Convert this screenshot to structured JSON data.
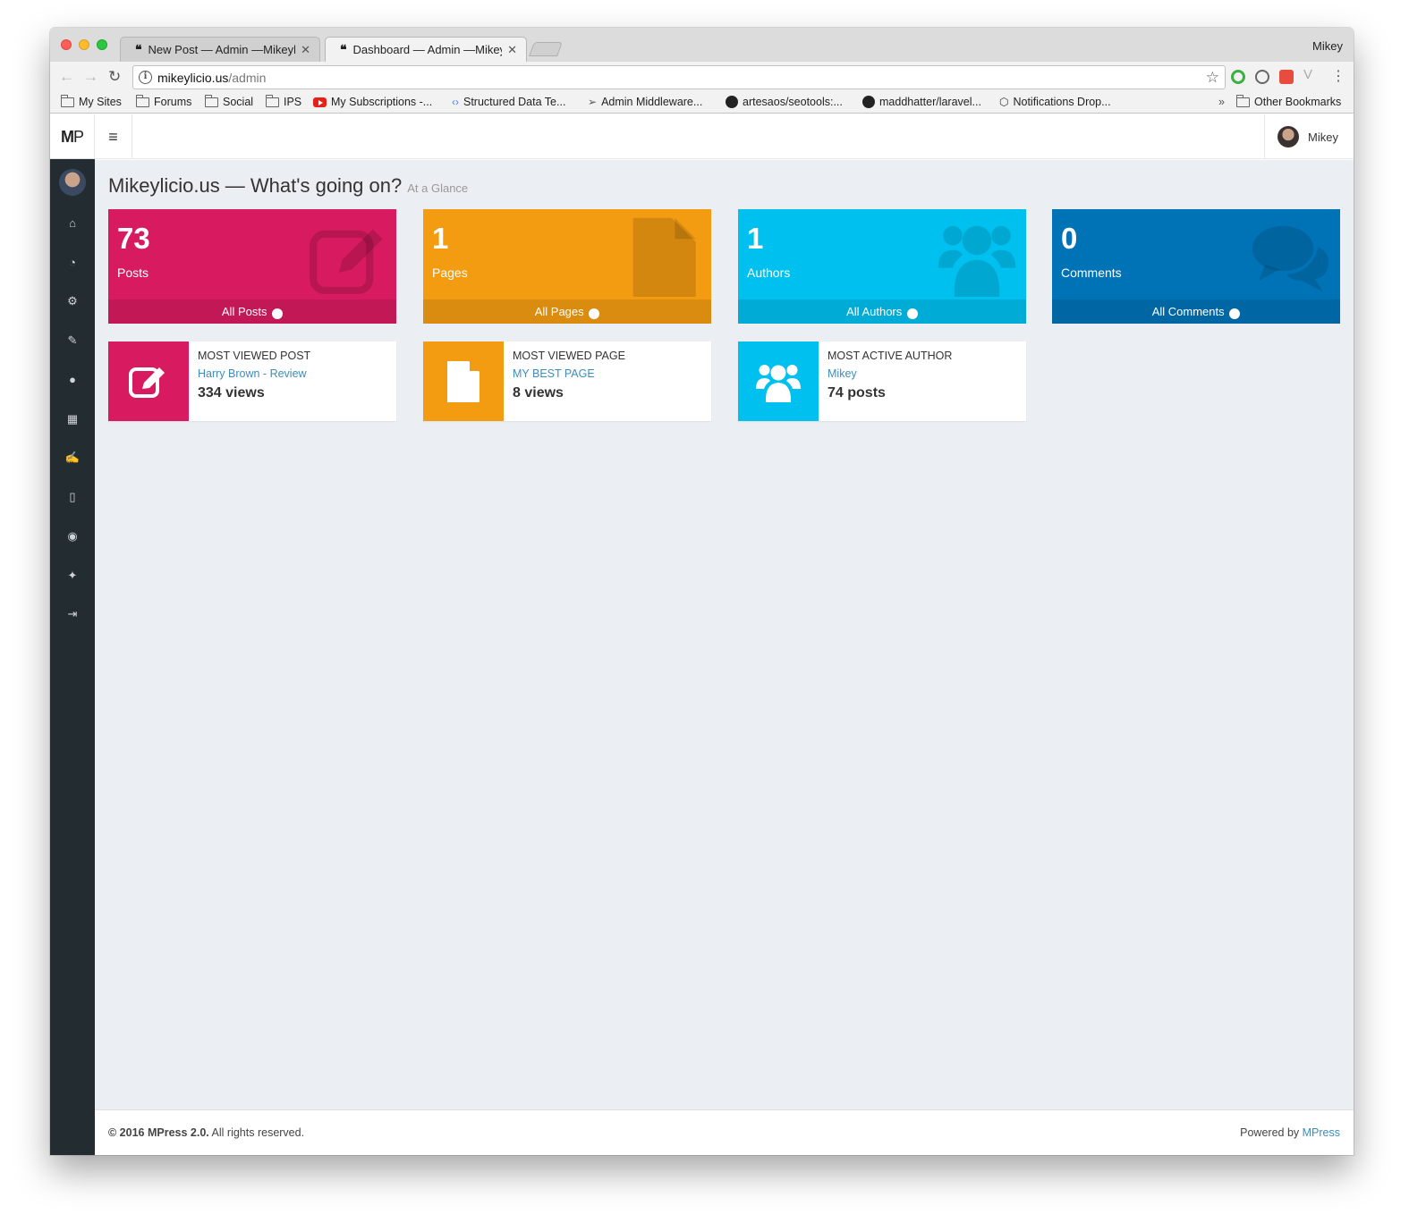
{
  "browser": {
    "profile_name": "Mikey",
    "tabs": [
      {
        "title": "New Post — Admin —Mikeylicio.us"
      },
      {
        "title": "Dashboard — Admin —Mikeylicio.us"
      }
    ],
    "url_host": "mikeylicio.us",
    "url_path": "/admin",
    "bookmarks": [
      {
        "label": "My Sites",
        "icon": "folder-icon"
      },
      {
        "label": "Forums",
        "icon": "folder-icon"
      },
      {
        "label": "Social",
        "icon": "folder-icon"
      },
      {
        "label": "IPS",
        "icon": "folder-icon"
      },
      {
        "label": "My Subscriptions -...",
        "icon": "youtube-icon"
      },
      {
        "label": "Structured Data Te...",
        "icon": "google-icon"
      },
      {
        "label": "Admin Middleware...",
        "icon": "send-icon"
      },
      {
        "label": "artesaos/seotools:...",
        "icon": "github-icon"
      },
      {
        "label": "maddhatter/laravel...",
        "icon": "github-icon"
      },
      {
        "label": "Notifications Drop...",
        "icon": "codepen-icon"
      }
    ],
    "bookmarks_overflow": "»",
    "other_bookmarks": "Other Bookmarks"
  },
  "app": {
    "logo_m": "M",
    "logo_p": "P",
    "user_name": "Mikey"
  },
  "sidebar_icons": [
    "home-icon",
    "dashboard-icon",
    "settings-icon",
    "brush-icon",
    "users-icon",
    "apps-grid-icon",
    "edit-icon",
    "page-icon",
    "comments-icon",
    "wrench-icon",
    "logout-icon"
  ],
  "page": {
    "title": "Mikeylicio.us — What's going on?",
    "subtitle": "At a Glance"
  },
  "stats": [
    {
      "value": "73",
      "label": "Posts",
      "link": "All Posts",
      "color": "#d81b60",
      "icon": "edit-icon"
    },
    {
      "value": "1",
      "label": "Pages",
      "link": "All Pages",
      "color": "#f39c12",
      "icon": "page-icon"
    },
    {
      "value": "1",
      "label": "Authors",
      "link": "All Authors",
      "color": "#00c0ef",
      "icon": "users-icon"
    },
    {
      "value": "0",
      "label": "Comments",
      "link": "All Comments",
      "color": "#0073b7",
      "icon": "comments-icon"
    }
  ],
  "highlights": [
    {
      "title": "MOST VIEWED POST",
      "link": "Harry Brown - Review",
      "value": "334 views",
      "color": "#d81b60",
      "icon": "edit-icon"
    },
    {
      "title": "MOST VIEWED PAGE",
      "link": "MY BEST PAGE",
      "value": "8 views",
      "color": "#f39c12",
      "icon": "page-icon"
    },
    {
      "title": "MOST ACTIVE AUTHOR",
      "link": "Mikey",
      "value": "74 posts",
      "color": "#00c0ef",
      "icon": "users-icon"
    }
  ],
  "footer": {
    "copyright": "© 2016 MPress 2.0.",
    "rights": " All rights reserved.",
    "powered_label": "Powered by ",
    "powered_link": "MPress"
  }
}
